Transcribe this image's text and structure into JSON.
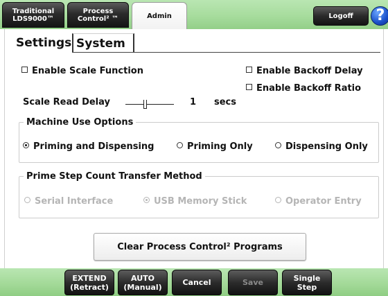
{
  "header": {
    "tabs": [
      {
        "line1": "Traditional",
        "line2": "LDS9000™"
      },
      {
        "line1": "Process",
        "line2": "Control² ™"
      },
      {
        "label": "Admin"
      }
    ],
    "logoff_label": "Logoff",
    "help_label": "?"
  },
  "subtabs": {
    "settings": "Settings",
    "system": "System"
  },
  "scale": {
    "enable_scale_label": "Enable Scale Function",
    "enable_scale_checked": false,
    "enable_backoff_delay_label": "Enable Backoff Delay",
    "enable_backoff_delay_checked": false,
    "enable_backoff_ratio_label": "Enable Backoff Ratio",
    "enable_backoff_ratio_checked": false,
    "read_delay_label": "Scale Read Delay",
    "read_delay_value": "1",
    "read_delay_unit": "secs"
  },
  "machine_use": {
    "legend": "Machine Use Options",
    "options": [
      {
        "label": "Priming and Dispensing",
        "selected": true
      },
      {
        "label": "Priming Only",
        "selected": false
      },
      {
        "label": "Dispensing Only",
        "selected": false
      }
    ]
  },
  "prime_transfer": {
    "legend": "Prime Step Count Transfer Method",
    "options": [
      {
        "label": "Serial Interface",
        "selected": false
      },
      {
        "label": "USB Memory Stick",
        "selected": true
      },
      {
        "label": "Operator Entry",
        "selected": false
      }
    ]
  },
  "clear_button_label": "Clear Process Control² Programs",
  "footer": {
    "extend_line1": "EXTEND",
    "extend_line2": "(Retract)",
    "auto_line1": "AUTO",
    "auto_line2": "(Manual)",
    "cancel_label": "Cancel",
    "save_label": "Save",
    "single_line1": "Single",
    "single_line2": "Step"
  },
  "colors": {
    "bar_green": "#a7dc9d",
    "button_dark": "#2b2b2b",
    "help_blue": "#1a4fc8",
    "disabled_text": "#b5b5b5"
  }
}
